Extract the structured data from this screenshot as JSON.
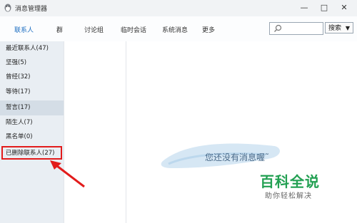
{
  "window": {
    "title": "消息管理器",
    "controls": {
      "minimize": "—",
      "maximize": "□",
      "close": "✕"
    }
  },
  "tabs": [
    {
      "label": "联系人"
    },
    {
      "label": "群"
    },
    {
      "label": "讨论组"
    },
    {
      "label": "临时会话"
    },
    {
      "label": "系统消息"
    },
    {
      "label": "更多"
    }
  ],
  "search": {
    "placeholder": "",
    "button_label": "搜索",
    "dropdown_arrow": "▼"
  },
  "sidebar": {
    "items": [
      {
        "label": "最近联系人(47)"
      },
      {
        "label": "坚强(5)"
      },
      {
        "label": "曾经(32)"
      },
      {
        "label": "等待(17)"
      },
      {
        "label": "誓言(17)"
      },
      {
        "label": "陌生人(7)"
      },
      {
        "label": "黑名单(0)"
      },
      {
        "label": "已删除联系人(27)"
      }
    ]
  },
  "main": {
    "empty_message": "您还没有消息喔˜"
  },
  "watermark": {
    "title": "百科全说",
    "subtitle": "助你轻松解决"
  },
  "colors": {
    "annotation": "#e21b1b",
    "active_tab": "#1e6fc2",
    "watermark": "#22a052"
  }
}
